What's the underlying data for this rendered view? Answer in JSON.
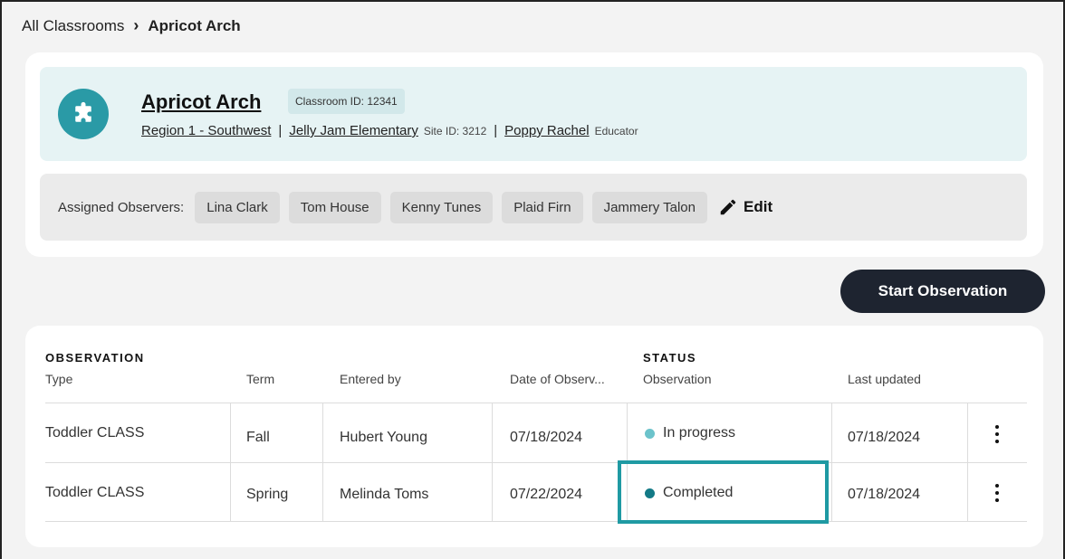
{
  "breadcrumb": {
    "parent": "All Classrooms",
    "separator": "›",
    "current": "Apricot Arch"
  },
  "classroom": {
    "name": "Apricot Arch",
    "id_label": "Classroom ID: 12341",
    "icon": "puzzle-icon",
    "region": "Region 1 - Southwest",
    "school": "Jelly Jam Elementary",
    "site_id": "Site ID: 3212",
    "educator_name": "Poppy Rachel",
    "educator_role": "Educator",
    "pipe": "|"
  },
  "observers": {
    "label": "Assigned Observers:",
    "names": [
      "Lina Clark",
      "Tom House",
      "Kenny Tunes",
      "Plaid Firn",
      "Jammery Talon"
    ],
    "edit_label": "Edit"
  },
  "actions": {
    "start_observation": "Start Observation"
  },
  "table": {
    "group_observation": "OBSERVATION",
    "group_status": "STATUS",
    "columns": [
      "Type",
      "Term",
      "Entered by",
      "Date of Observ...",
      "Observation",
      "Last updated"
    ],
    "rows": [
      {
        "type": "Toddler CLASS",
        "term": "Fall",
        "entered_by": "Hubert Young",
        "date": "07/18/2024",
        "status": "In progress",
        "status_color": "#6cc3cb",
        "last_updated": "07/18/2024"
      },
      {
        "type": "Toddler CLASS",
        "term": "Spring",
        "entered_by": "Melinda Toms",
        "date": "07/22/2024",
        "status": "Completed",
        "status_color": "#137a86",
        "last_updated": "07/18/2024"
      }
    ]
  },
  "colors": {
    "accent": "#2a9aa6",
    "highlight": "#1f9aa3",
    "button_dark": "#1e2430",
    "header_bg": "#e6f3f4"
  }
}
